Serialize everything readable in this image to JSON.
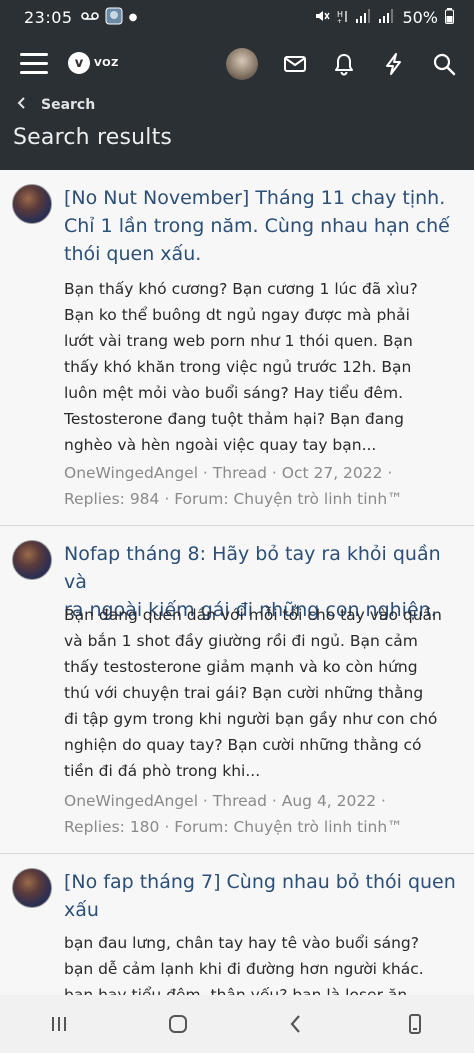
{
  "status_bar": {
    "time": "23:05",
    "battery": "50%",
    "icons": [
      "voicemail-icon",
      "gallery-icon",
      "mute-icon",
      "wifi-icon",
      "signal-icon",
      "battery-icon"
    ]
  },
  "nav": {
    "logo_text": "VOZ",
    "logo_mark": "v"
  },
  "breadcrumb": {
    "label": "Search"
  },
  "page_title": "Search results",
  "results": [
    {
      "title_line1": "[No Nut November] Tháng 11 chay tịnh.",
      "title_line2": "Chỉ 1 lần trong năm. Cùng nhau hạn chế",
      "title_line3": "thói quen xấu.",
      "body": [
        "Bạn thấy khó cương? Bạn cương 1 lúc đã xìu?",
        "Bạn ko thể buông dt ngủ ngay được mà phải",
        "lướt vài trang web porn như 1 thói quen. Bạn",
        "thấy khó khăn trong việc ngủ trước 12h. Bạn",
        "luôn mệt mỏi vào buổi sáng? Hay tiểu đêm.",
        "Testosterone đang tuột thảm hại? Bạn đang",
        "nghèo và hèn ngoài việc quay tay bạn..."
      ],
      "meta_line1": "OneWingedAngel · Thread · Oct 27, 2022 ·",
      "meta_line2": "Replies: 984 · Forum: Chuyện trò linh tinh™"
    },
    {
      "title_line1": "Nofap tháng 8: Hãy bỏ tay ra khỏi quần và",
      "title_line2": "ra ngoài kiếm gái đi những con nghiện.",
      "body": [
        "Bạn đang quen dần với mỗi tối cho tay vào quần",
        "và bắn 1 shot đầy giường rồi đi ngủ. Bạn cảm",
        "thấy testosterone giảm mạnh và ko còn hứng",
        "thú với chuyện trai gái? Bạn cười những thằng",
        "đi tập gym trong khi người bạn gầy như con chó",
        "nghiện do quay tay? Bạn cười những thằng có",
        "tiền đi đá phò trong khi..."
      ],
      "meta_line1": "OneWingedAngel · Thread · Aug 4, 2022 ·",
      "meta_line2": "Replies: 180 · Forum: Chuyện trò linh tinh™"
    },
    {
      "title_line1": "[No fap tháng 7] Cùng nhau bỏ thói quen",
      "title_line2": "xấu",
      "body": [
        "bạn đau lưng, chân tay hay tê vào buổi sáng?",
        "bạn dễ cảm lạnh khi đi đường hơn người khác.",
        "bạn hay tiểu đêm, thận yếu? bạn là loser ăn"
      ]
    }
  ]
}
